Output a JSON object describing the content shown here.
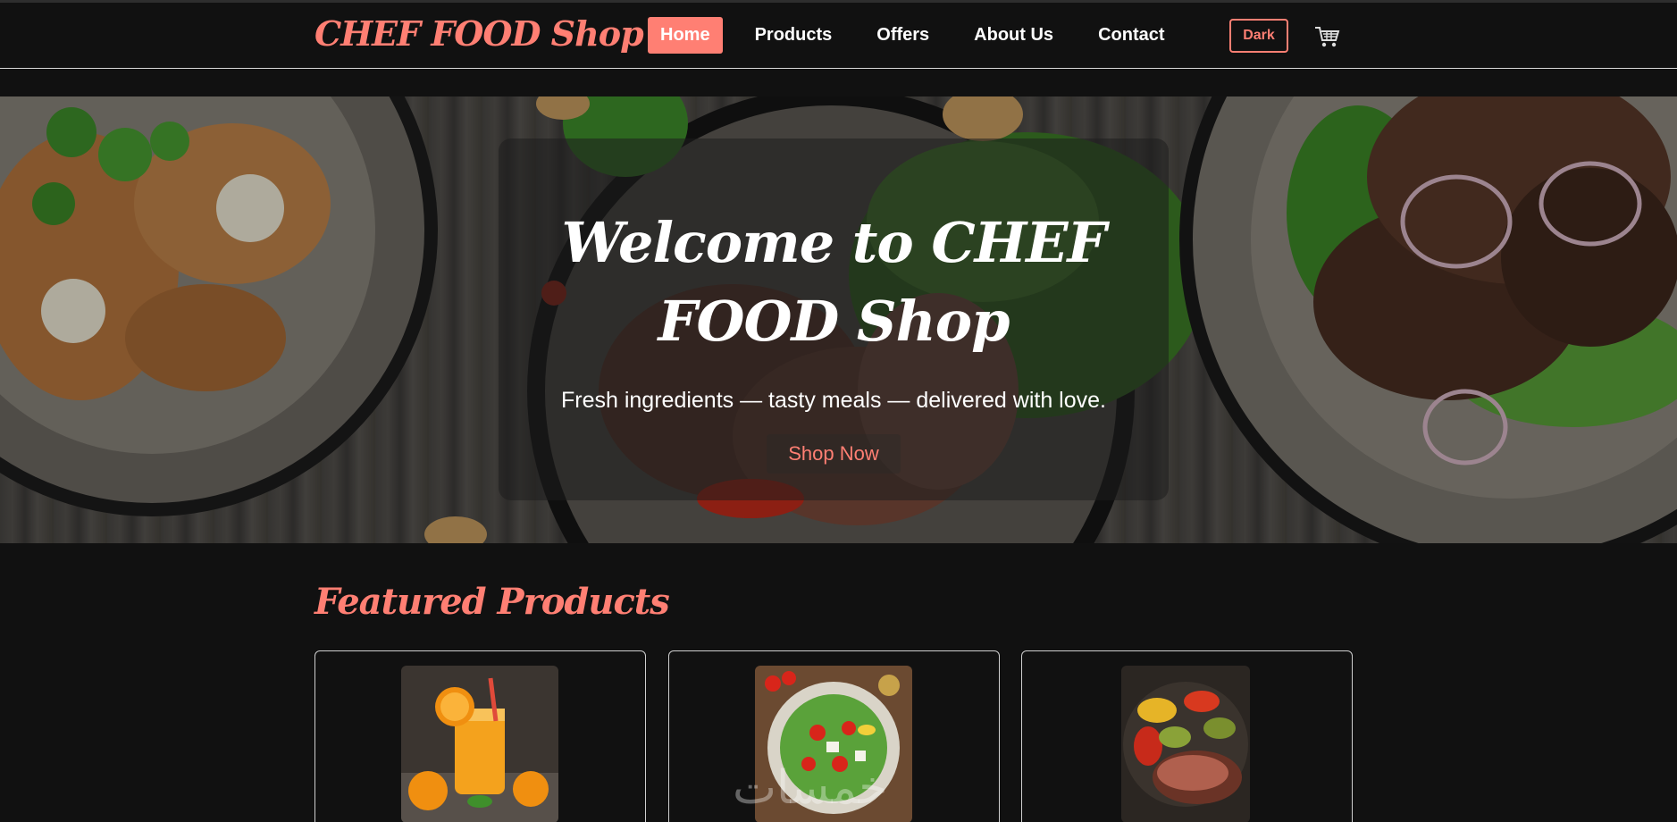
{
  "brand": {
    "name": "CHEF FOOD Shop"
  },
  "nav": {
    "items": [
      {
        "label": "Home",
        "active": true
      },
      {
        "label": "Products",
        "active": false
      },
      {
        "label": "Offers",
        "active": false
      },
      {
        "label": "About Us",
        "active": false
      },
      {
        "label": "Contact",
        "active": false
      }
    ],
    "theme_toggle_label": "Dark",
    "cart_icon": "cart-icon"
  },
  "hero": {
    "title": "Welcome to CHEF FOOD Shop",
    "subtitle": "Fresh ingredients — tasty meals — delivered with love.",
    "cta_label": "Shop Now"
  },
  "featured": {
    "title": "Featured Products",
    "products": [
      {
        "image": "orange-juice-image"
      },
      {
        "image": "salad-image"
      },
      {
        "image": "grilled-steak-image"
      }
    ]
  },
  "colors": {
    "accent": "#ff7f73",
    "background": "#111111",
    "text": "#ffffff"
  }
}
